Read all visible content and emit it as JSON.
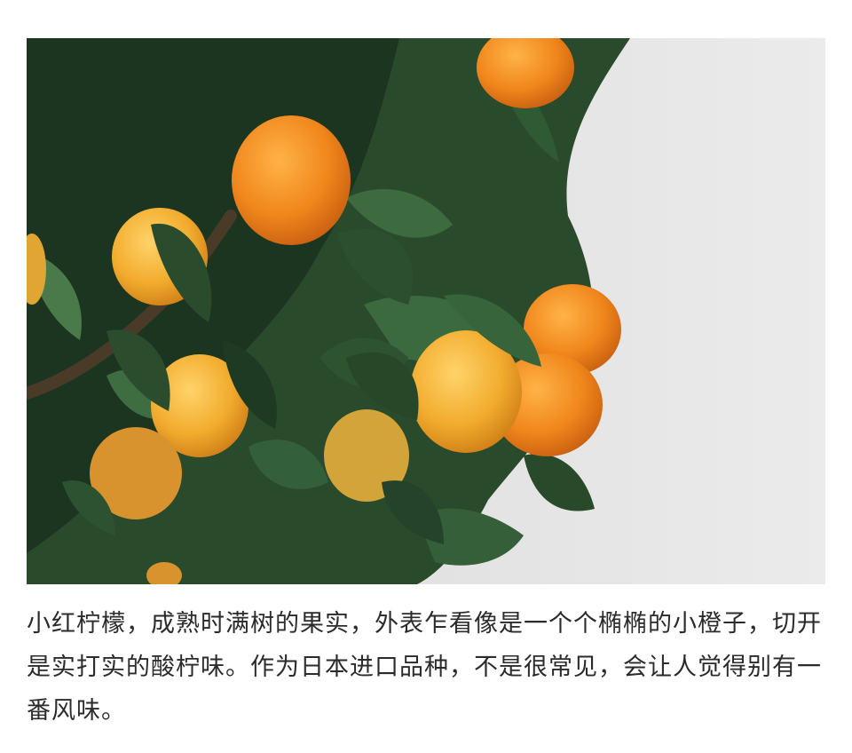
{
  "photo": {
    "subject_icon": "orange-tree-photo",
    "colors": {
      "background": "#e6e6e6",
      "leaf_dark": "#1f3a22",
      "leaf_mid": "#2f5a33",
      "fruit_orange": "#f08a1e",
      "fruit_yellow": "#f1b334"
    }
  },
  "caption": {
    "text": "小红柠檬，成熟时满树的果实，外表乍看像是一个个椭椭的小橙子，切开是实打实的酸柠味。作为日本进口品种，不是很常见，会让人觉得别有一番风味。"
  }
}
